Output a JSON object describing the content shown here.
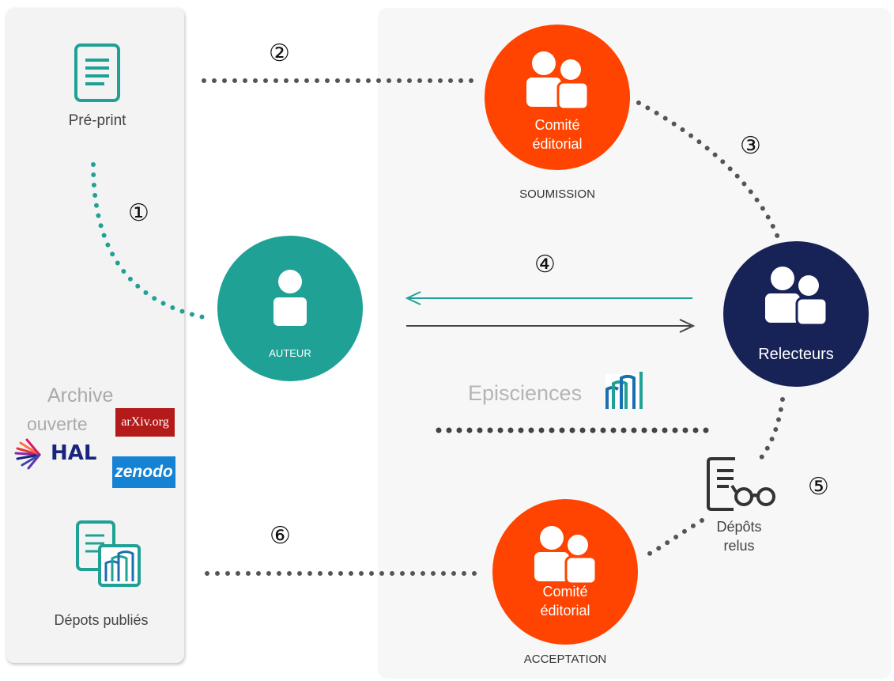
{
  "colors": {
    "teal": "#1fa195",
    "orange": "#fe4400",
    "navy": "#172257",
    "gray_dots": "#555555",
    "hal": "#1a237e",
    "arxiv": "#b31b1b",
    "zenodo": "#1682d4",
    "episciences_text": "#b5b5b5"
  },
  "left_panel": {
    "preprint_label": "Pré-print",
    "archive_title_line1": "Archive",
    "archive_title_line2": "ouverte",
    "arxiv_logo": "arXiv.org",
    "hal_logo": "HAL",
    "zenodo_logo": "zenodo",
    "depots_publies_label": "Dépots publiés"
  },
  "nodes": {
    "auteur": {
      "label": "AUTEUR",
      "icon": "single-person-icon"
    },
    "comite_soumission": {
      "label_line1": "Comité",
      "label_line2": "éditorial",
      "caption": "SOUMISSION",
      "icon": "two-persons-icon"
    },
    "relecteurs": {
      "label": "Relecteurs",
      "icon": "two-persons-icon"
    },
    "comite_acceptation": {
      "label_line1": "Comité",
      "label_line2": "éditorial",
      "caption": "ACCEPTATION",
      "icon": "two-persons-icon"
    },
    "depots_relus": {
      "label_line1": "Dépôts",
      "label_line2": "relus",
      "icon": "document-glasses-icon"
    }
  },
  "episciences": {
    "label": "Episciences"
  },
  "steps": [
    "①",
    "②",
    "③",
    "④",
    "⑤",
    "⑥"
  ]
}
